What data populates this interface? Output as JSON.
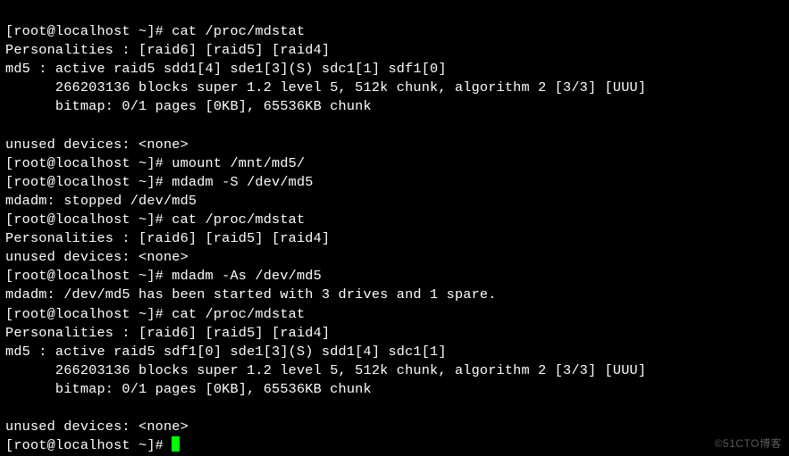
{
  "prompt": "[root@localhost ~]# ",
  "cmd": {
    "cat1": "cat /proc/mdstat",
    "umount": "umount /mnt/md5/",
    "stop": "mdadm -S /dev/md5",
    "cat2": "cat /proc/mdstat",
    "assemble": "mdadm -As /dev/md5",
    "cat3": "cat /proc/mdstat"
  },
  "out": {
    "pers": "Personalities : [raid6] [raid5] [raid4]",
    "md5_a1": "md5 : active raid5 sdd1[4] sde1[3](S) sdc1[1] sdf1[0]",
    "blocks": "      266203136 blocks super 1.2 level 5, 512k chunk, algorithm 2 [3/3] [UUU]",
    "bitmap": "      bitmap: 0/1 pages [0KB], 65536KB chunk",
    "unused": "unused devices: <none>",
    "stopped": "mdadm: stopped /dev/md5",
    "started": "mdadm: /dev/md5 has been started with 3 drives and 1 spare.",
    "md5_a2": "md5 : active raid5 sdf1[0] sde1[3](S) sdd1[4] sdc1[1]"
  },
  "watermark": "©51CTO博客"
}
